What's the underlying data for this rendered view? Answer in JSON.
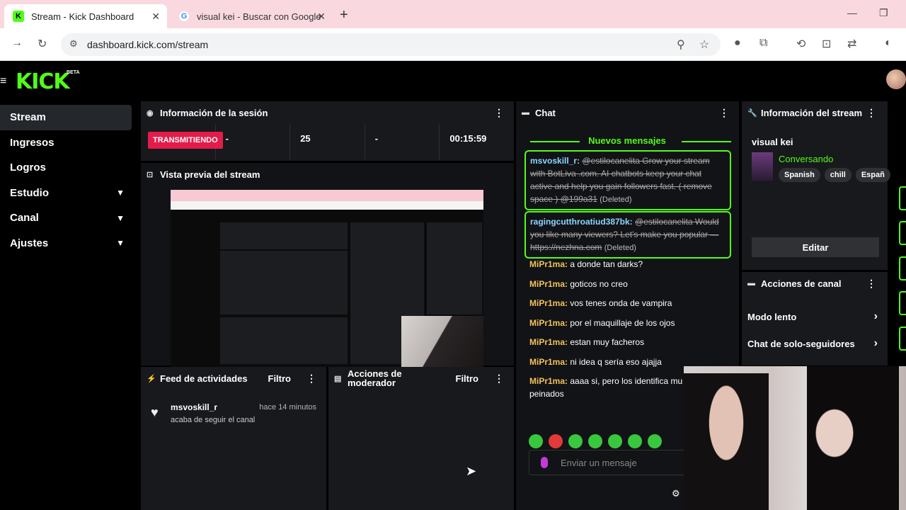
{
  "browser": {
    "tabs": [
      {
        "title": "Stream - Kick Dashboard",
        "favicon": "kick-icon"
      },
      {
        "title": "visual kei - Buscar con Google",
        "favicon": "google-icon"
      }
    ],
    "url": "dashboard.kick.com/stream"
  },
  "app": {
    "logo": "KICK",
    "beta": "BETA",
    "accent": "#53fc18"
  },
  "sidebar": {
    "items": [
      {
        "label": "Stream",
        "active": true
      },
      {
        "label": "Ingresos"
      },
      {
        "label": "Logros"
      },
      {
        "label": "Estudio",
        "expandable": true
      },
      {
        "label": "Canal",
        "expandable": true
      },
      {
        "label": "Ajustes",
        "expandable": true
      }
    ]
  },
  "session": {
    "title": "Información de la sesión",
    "status": "TRANSMITIENDO",
    "stats": [
      "-",
      "25",
      "-",
      "00:15:59"
    ]
  },
  "preview": {
    "title": "Vista previa del stream"
  },
  "feed": {
    "title": "Feed de actividades",
    "filter": "Filtro",
    "item": {
      "name": "msvoskill_r",
      "time": "hace 14 minutos",
      "desc": "acaba de seguir el canal"
    }
  },
  "moderator": {
    "title": "Acciones de moderador",
    "filter": "Filtro"
  },
  "chat": {
    "title": "Chat",
    "new_messages": "Nuevos mensajes",
    "deleted": [
      {
        "user": "msvoskill_r:",
        "text": "@estilocanelita Grow your stream with BotLiva .com. AI chatbots keep your chat active and help you gain followers fast. ( remove space ) @199a31",
        "tag": "(Deleted)"
      },
      {
        "user": "ragingcutthroatiud387bk:",
        "text": "@estilocanelita Would you like many viewers? Let's make you popular — https://nezhna.com",
        "tag": "(Deleted)"
      }
    ],
    "messages": [
      {
        "user": "MiPr1ma:",
        "text": "a donde tan darks?"
      },
      {
        "user": "MiPr1ma:",
        "text": "goticos no creo"
      },
      {
        "user": "MiPr1ma:",
        "text": "vos tenes onda de vampira"
      },
      {
        "user": "MiPr1ma:",
        "text": "por el maquillaje de los ojos"
      },
      {
        "user": "MiPr1ma:",
        "text": "estan muy facheros"
      },
      {
        "user": "MiPr1ma:",
        "text": "ni idea q sería eso ajajja"
      },
      {
        "user": "MiPr1ma:",
        "text": "aaaa si, pero los identifica mu peinados"
      }
    ],
    "input_placeholder": "Enviar un mensaje"
  },
  "stream_info": {
    "title": "Información del stream",
    "stream_title": "visual kei",
    "category": "Conversando",
    "tags": [
      "Spanish",
      "chill",
      "Españ"
    ],
    "edit": "Editar"
  },
  "channel_actions": {
    "title": "Acciones de canal",
    "items": [
      "Modo lento",
      "Chat de solo-seguidores"
    ]
  }
}
